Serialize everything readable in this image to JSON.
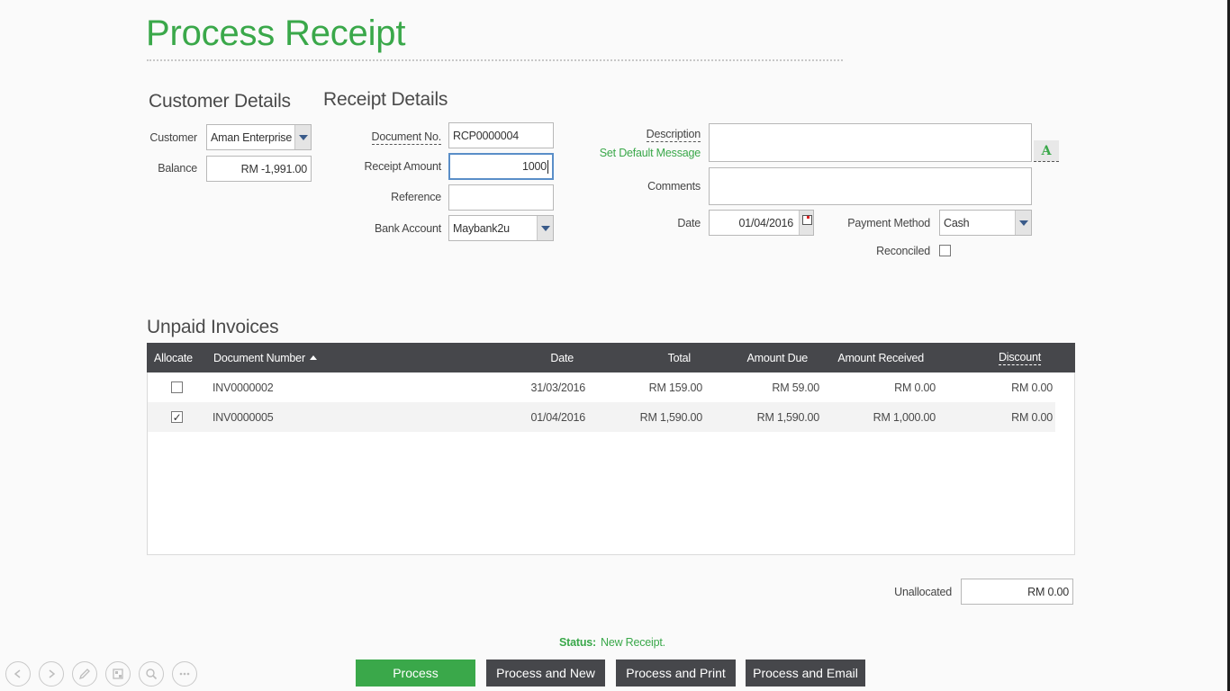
{
  "page": {
    "title": "Process Receipt"
  },
  "customer_details": {
    "heading": "Customer Details",
    "customer_label": "Customer",
    "customer_value": "Aman Enterprise",
    "balance_label": "Balance",
    "balance_value": "RM -1,991.00"
  },
  "receipt_details": {
    "heading": "Receipt Details",
    "document_no_label": "Document No.",
    "document_no_value": "RCP0000004",
    "receipt_amount_label": "Receipt Amount",
    "receipt_amount_value": "1000",
    "reference_label": "Reference",
    "reference_value": "",
    "bank_account_label": "Bank Account",
    "bank_account_value": "Maybank2u",
    "description_label": "Description",
    "set_default_message": "Set Default Message",
    "description_value": "",
    "comments_label": "Comments",
    "comments_value": "",
    "date_label": "Date",
    "date_value": "01/04/2016",
    "payment_method_label": "Payment Method",
    "payment_method_value": "Cash",
    "reconciled_label": "Reconciled",
    "reconciled_checked": false
  },
  "unpaid_invoices": {
    "heading": "Unpaid Invoices",
    "columns": {
      "allocate": "Allocate",
      "document_number": "Document Number",
      "date": "Date",
      "total": "Total",
      "amount_due": "Amount Due",
      "amount_received": "Amount Received",
      "discount": "Discount"
    },
    "rows": [
      {
        "checked": false,
        "check_glyph": "",
        "document_number": "INV0000002",
        "date": "31/03/2016",
        "total": "RM 159.00",
        "amount_due": "RM 59.00",
        "amount_received": "RM 0.00",
        "discount": "RM 0.00"
      },
      {
        "checked": true,
        "check_glyph": "✓",
        "document_number": "INV0000005",
        "date": "01/04/2016",
        "total": "RM 1,590.00",
        "amount_due": "RM 1,590.00",
        "amount_received": "RM 1,000.00",
        "discount": "RM 0.00"
      }
    ]
  },
  "unallocated": {
    "label": "Unallocated",
    "value": "RM 0.00"
  },
  "status": {
    "label": "Status:",
    "value": "New Receipt."
  },
  "actions": {
    "process": "Process",
    "process_and_new": "Process and New",
    "process_and_print": "Process and Print",
    "process_and_email": "Process and Email"
  },
  "icons": {
    "font_button": "A",
    "nav": [
      "back-icon",
      "forward-icon",
      "pen-icon",
      "slides-icon",
      "zoom-icon",
      "more-icon"
    ]
  },
  "colors": {
    "accent": "#3aa84a",
    "header": "#46474b"
  }
}
